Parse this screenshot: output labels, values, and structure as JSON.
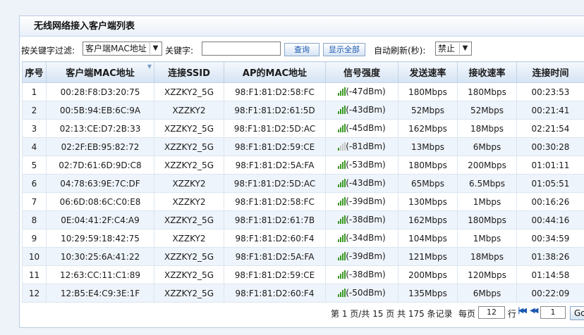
{
  "panel": {
    "title": "无线网络接入客户端列表"
  },
  "toolbar": {
    "filter_label": "按关键字过滤:",
    "filter_select": "客户端MAC地址",
    "keyword_label": "关键字:",
    "keyword_value": "",
    "search_button": "查询",
    "show_all_button": "显示全部",
    "refresh_label": "自动刷新(秒):",
    "refresh_select": "禁止"
  },
  "table": {
    "columns": [
      "序号",
      "客户端MAC地址",
      "连接SSID",
      "AP的MAC地址",
      "信号强度",
      "发送速率",
      "接收速率",
      "连接时间"
    ],
    "rows": [
      {
        "no": "1",
        "mac": "00:28:F8:D3:20:75",
        "ssid": "XZZKY2_5G",
        "ap": "98:F1:81:D2:58:FC",
        "signal": "(-47dBm)",
        "level": 4,
        "tx": "180Mbps",
        "rx": "180Mbps",
        "time": "00:23:53"
      },
      {
        "no": "2",
        "mac": "00:5B:94:EB:6C:9A",
        "ssid": "XZZKY2",
        "ap": "98:F1:81:D2:61:5D",
        "signal": "(-43dBm)",
        "level": 4,
        "tx": "52Mbps",
        "rx": "52Mbps",
        "time": "00:21:41"
      },
      {
        "no": "3",
        "mac": "02:13:CE:D7:2B:33",
        "ssid": "XZZKY2_5G",
        "ap": "98:F1:81:D2:5D:AC",
        "signal": "(-45dBm)",
        "level": 4,
        "tx": "162Mbps",
        "rx": "18Mbps",
        "time": "02:21:54"
      },
      {
        "no": "4",
        "mac": "02:2F:EB:95:82:72",
        "ssid": "XZZKY2_5G",
        "ap": "98:F1:81:D2:59:CE",
        "signal": "(-81dBm)",
        "level": 1,
        "tx": "13Mbps",
        "rx": "6Mbps",
        "time": "00:30:28"
      },
      {
        "no": "5",
        "mac": "02:7D:61:6D:9D:C8",
        "ssid": "XZZKY2_5G",
        "ap": "98:F1:81:D2:5A:FA",
        "signal": "(-53dBm)",
        "level": 4,
        "tx": "180Mbps",
        "rx": "200Mbps",
        "time": "01:01:11"
      },
      {
        "no": "6",
        "mac": "04:78:63:9E:7C:DF",
        "ssid": "XZZKY2",
        "ap": "98:F1:81:D2:5D:AC",
        "signal": "(-43dBm)",
        "level": 4,
        "tx": "65Mbps",
        "rx": "6.5Mbps",
        "time": "01:05:51"
      },
      {
        "no": "7",
        "mac": "06:6D:08:6C:C0:E8",
        "ssid": "XZZKY2",
        "ap": "98:F1:81:D2:58:FC",
        "signal": "(-39dBm)",
        "level": 4,
        "tx": "130Mbps",
        "rx": "1Mbps",
        "time": "00:16:26"
      },
      {
        "no": "8",
        "mac": "0E:04:41:2F:C4:A9",
        "ssid": "XZZKY2_5G",
        "ap": "98:F1:81:D2:61:7B",
        "signal": "(-38dBm)",
        "level": 4,
        "tx": "162Mbps",
        "rx": "180Mbps",
        "time": "00:44:16"
      },
      {
        "no": "9",
        "mac": "10:29:59:18:42:75",
        "ssid": "XZZKY2",
        "ap": "98:F1:81:D2:60:F4",
        "signal": "(-34dBm)",
        "level": 4,
        "tx": "104Mbps",
        "rx": "1Mbps",
        "time": "00:34:59"
      },
      {
        "no": "10",
        "mac": "10:30:25:6A:41:22",
        "ssid": "XZZKY2_5G",
        "ap": "98:F1:81:D2:5A:FA",
        "signal": "(-39dBm)",
        "level": 4,
        "tx": "121Mbps",
        "rx": "18Mbps",
        "time": "01:38:26"
      },
      {
        "no": "11",
        "mac": "12:63:CC:11:C1:89",
        "ssid": "XZZKY2_5G",
        "ap": "98:F1:81:D2:59:CE",
        "signal": "(-38dBm)",
        "level": 4,
        "tx": "200Mbps",
        "rx": "120Mbps",
        "time": "01:14:58"
      },
      {
        "no": "12",
        "mac": "12:B5:E4:C9:3E:1F",
        "ssid": "XZZKY2_5G",
        "ap": "98:F1:81:D2:60:F4",
        "signal": "(-50dBm)",
        "level": 4,
        "tx": "135Mbps",
        "rx": "6Mbps",
        "time": "00:22:09"
      }
    ]
  },
  "pager": {
    "status": "第 1 页/共 15 页 共 175 条记录",
    "per_page_label": "每页",
    "per_page_value": "12",
    "rows_suffix": "行",
    "first_icon": "first-page-icon",
    "prev_icon": "previous-page-icon",
    "page_value": "1",
    "go_button": "Go"
  },
  "colors": {
    "signal_bar": "#3a9a22",
    "header_bg": "#d5e3f3",
    "row_alt": "#eef4fb",
    "link_blue": "#1b58b0"
  }
}
